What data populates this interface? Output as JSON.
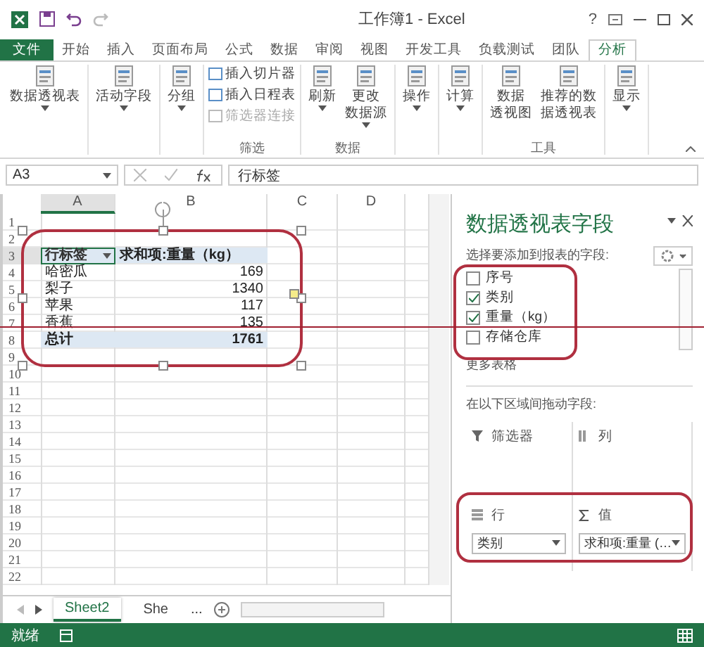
{
  "window": {
    "title": "工作簿1 - Excel",
    "controls": [
      "?"
    ]
  },
  "ribbon_tabs": [
    {
      "label": "文件",
      "kind": "file",
      "selected": false
    },
    {
      "label": "开始",
      "kind": "tab",
      "selected": false
    },
    {
      "label": "插入",
      "kind": "tab",
      "selected": false
    },
    {
      "label": "页面布局",
      "kind": "tab",
      "selected": false
    },
    {
      "label": "公式",
      "kind": "tab",
      "selected": false
    },
    {
      "label": "数据",
      "kind": "tab",
      "selected": false
    },
    {
      "label": "审阅",
      "kind": "tab",
      "selected": false
    },
    {
      "label": "视图",
      "kind": "tab",
      "selected": false
    },
    {
      "label": "开发工具",
      "kind": "tab",
      "selected": false
    },
    {
      "label": "负载测试",
      "kind": "tab",
      "selected": false
    },
    {
      "label": "团队",
      "kind": "tab",
      "selected": false
    },
    {
      "label": "分析",
      "kind": "tab",
      "selected": true
    }
  ],
  "ribbon_groups": [
    {
      "buttons": [
        {
          "kind": "large",
          "lines": [
            "数据透视表"
          ],
          "dropdown": true
        }
      ]
    },
    {
      "buttons": [
        {
          "kind": "large",
          "lines": [
            "活动字段"
          ],
          "dropdown": true
        }
      ]
    },
    {
      "buttons": [
        {
          "kind": "large",
          "lines": [
            "分组"
          ],
          "dropdown": true
        }
      ]
    },
    {
      "label": "筛选",
      "buttons": [
        {
          "kind": "small",
          "label": "插入切片器",
          "disabled": false
        },
        {
          "kind": "small",
          "label": "插入日程表",
          "disabled": false
        },
        {
          "kind": "small",
          "label": "筛选器连接",
          "disabled": true
        }
      ]
    },
    {
      "label": "数据",
      "buttons": [
        {
          "kind": "large",
          "lines": [
            "刷新"
          ],
          "dropdown": true
        },
        {
          "kind": "large",
          "lines": [
            "更改",
            "数据源"
          ],
          "dropdown": true
        }
      ]
    },
    {
      "buttons": [
        {
          "kind": "large",
          "lines": [
            "操作"
          ],
          "dropdown": true
        }
      ]
    },
    {
      "buttons": [
        {
          "kind": "large",
          "lines": [
            "计算"
          ],
          "dropdown": true
        }
      ]
    },
    {
      "label": "工具",
      "buttons": [
        {
          "kind": "large",
          "lines": [
            "数据",
            "透视图"
          ],
          "dropdown": false
        },
        {
          "kind": "large",
          "lines": [
            "推荐的数",
            "据透视表"
          ],
          "dropdown": false
        }
      ]
    },
    {
      "buttons": [
        {
          "kind": "large",
          "lines": [
            "显示"
          ],
          "dropdown": true
        }
      ]
    }
  ],
  "formula_bar": {
    "name_box": "A3",
    "value": "行标签"
  },
  "columns": [
    {
      "label": "A",
      "selected": true
    },
    {
      "label": "B",
      "selected": false
    },
    {
      "label": "C",
      "selected": false
    },
    {
      "label": "D",
      "selected": false
    }
  ],
  "rows": [
    {
      "label": "1",
      "selected": false
    },
    {
      "label": "2",
      "selected": false
    },
    {
      "label": "3",
      "selected": true
    },
    {
      "label": "4",
      "selected": false
    },
    {
      "label": "5",
      "selected": false
    },
    {
      "label": "6",
      "selected": false
    },
    {
      "label": "7",
      "selected": false
    },
    {
      "label": "8",
      "selected": false
    },
    {
      "label": "9",
      "selected": false
    },
    {
      "label": "10",
      "selected": false
    },
    {
      "label": "11",
      "selected": false
    },
    {
      "label": "12",
      "selected": false
    },
    {
      "label": "13",
      "selected": false
    },
    {
      "label": "14",
      "selected": false
    },
    {
      "label": "15",
      "selected": false
    },
    {
      "label": "16",
      "selected": false
    },
    {
      "label": "17",
      "selected": false
    },
    {
      "label": "18",
      "selected": false
    },
    {
      "label": "19",
      "selected": false
    },
    {
      "label": "20",
      "selected": false
    },
    {
      "label": "21",
      "selected": false
    },
    {
      "label": "22",
      "selected": false
    }
  ],
  "pivot": {
    "row_label": "行标签",
    "value_label": "求和项:重量（kg）",
    "items": [
      {
        "label": "哈密瓜",
        "value": "169"
      },
      {
        "label": "梨子",
        "value": "1340"
      },
      {
        "label": "苹果",
        "value": "117"
      },
      {
        "label": "香蕉",
        "value": "135"
      }
    ],
    "total": {
      "label": "总计",
      "value": "1761"
    }
  },
  "pane": {
    "title": "数据透视表字段",
    "subtitle": "选择要添加到报表的字段:",
    "fields": [
      {
        "label": "序号",
        "checked": false
      },
      {
        "label": "类别",
        "checked": true
      },
      {
        "label": "重量（kg）",
        "checked": true
      },
      {
        "label": "存储仓库",
        "checked": false
      }
    ],
    "more": "更多表格",
    "drag_hint": "在以下区域间拖动字段:",
    "areas": [
      {
        "kind": "filter",
        "label": "筛选器"
      },
      {
        "kind": "columns",
        "label": "列"
      },
      {
        "kind": "rows",
        "label": "行",
        "items": [
          "类别"
        ]
      },
      {
        "kind": "values",
        "label": "值",
        "items": [
          "求和项:重量 (…"
        ]
      }
    ]
  },
  "sheet_tabs": [
    {
      "label": "Sheet2",
      "selected": true
    },
    {
      "label": "She",
      "selected": false
    }
  ],
  "more_tabs": "...",
  "status_bar": {
    "text": "就绪"
  }
}
